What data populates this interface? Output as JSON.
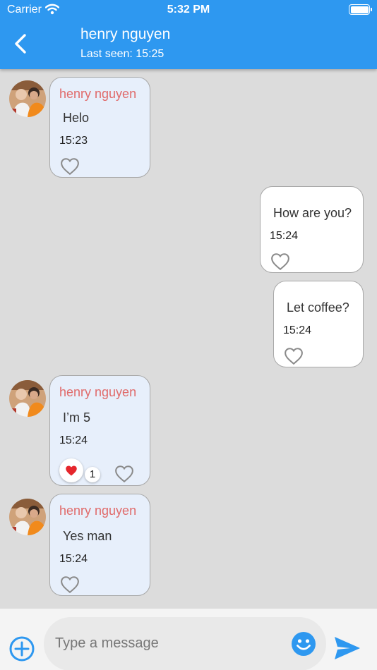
{
  "status_bar": {
    "carrier": "Carrier",
    "time": "5:32 PM"
  },
  "header": {
    "title": "henry nguyen",
    "subtitle": "Last seen: 15:25",
    "back_icon": "chevron-left-icon",
    "background": "#2e98f0"
  },
  "messages": [
    {
      "direction": "incoming",
      "sender": "henry nguyen",
      "text": "Helo",
      "time": "15:23",
      "liked": false
    },
    {
      "direction": "outgoing",
      "text": "How are you?",
      "time": "15:24",
      "liked": false
    },
    {
      "direction": "outgoing",
      "text": "Let coffee?",
      "time": "15:24",
      "liked": false
    },
    {
      "direction": "incoming",
      "sender": "henry nguyen",
      "text": "I’m 5",
      "time": "15:24",
      "reaction": {
        "emoji": "red-heart",
        "count": "1"
      },
      "liked": false
    },
    {
      "direction": "incoming",
      "sender": "henry nguyen",
      "text": "Yes man",
      "time": "15:24",
      "liked": false
    }
  ],
  "composer": {
    "placeholder": "Type a message",
    "add_icon": "plus-circle-icon",
    "emoji_icon": "smiley-icon",
    "send_icon": "send-icon"
  },
  "colors": {
    "accent": "#2e98f0",
    "sender_name": "#e06a6a",
    "incoming_bubble": "#e7effb",
    "outgoing_bubble": "#ffffff",
    "chat_background": "#dcdcdc"
  }
}
